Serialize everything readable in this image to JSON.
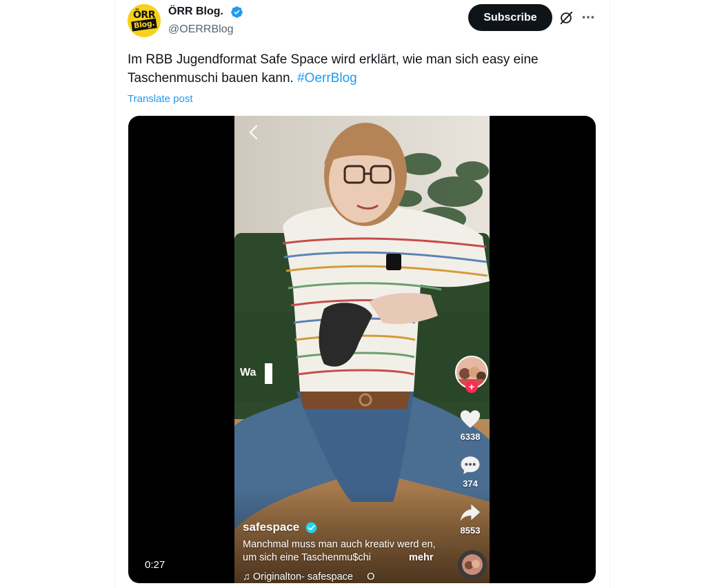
{
  "author": {
    "name": "ÖRR Blog.",
    "handle": "@OERRBlog",
    "avatar_text_top": "ÖRR",
    "avatar_text_bottom": "Blog.",
    "avatar_color": "#f7d21b",
    "verified_color": "#1d9bf0"
  },
  "header": {
    "subscribe_label": "Subscribe",
    "grok_icon": "grok-slash-icon",
    "more_icon": "more-dots-icon"
  },
  "post": {
    "text": "Im RBB Jugendformat Safe Space wird erklärt, wie man sich easy eine Taschenmuschi bauen kann. ",
    "hashtag": "#OerrBlog",
    "translate_label": "Translate post",
    "link_color": "#1d9bf0"
  },
  "video": {
    "duration": "0:27",
    "overlay_caption": "Wa",
    "likes": "6338",
    "comments": "374",
    "shares": "8553",
    "username": "safespace",
    "description": "Manchmal muss man auch kreativ werd en, um sich eine Taschenmu$chi",
    "more_label": "mehr",
    "sound": "♫ Originalton- safespace",
    "sound_extra": "O",
    "follow_symbol": "+",
    "accent_color": "#fe2c55"
  }
}
